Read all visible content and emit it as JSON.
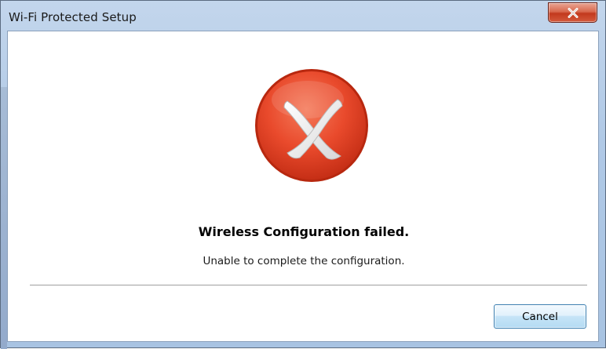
{
  "window": {
    "title": "Wi-Fi Protected Setup"
  },
  "dialog": {
    "icon": "error-x-icon",
    "heading": "Wireless Configuration failed.",
    "message": "Unable to complete the configuration.",
    "cancel_label": "Cancel"
  },
  "colors": {
    "error_red": "#e94a2c",
    "close_button_red": "#c2391d",
    "titlebar_blue": "#b0c9e6",
    "button_border_blue": "#3c7fb1"
  }
}
